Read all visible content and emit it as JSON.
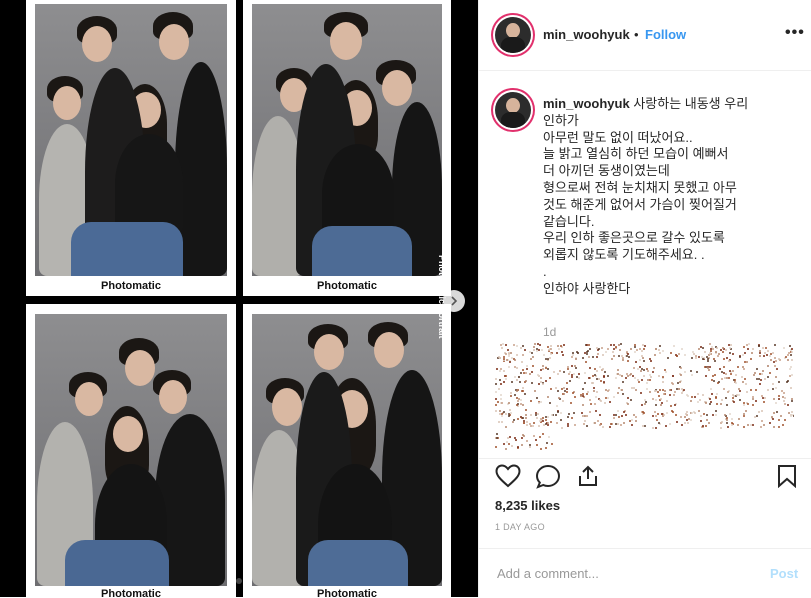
{
  "post": {
    "username": "min_woohyuk",
    "follow_label": "Follow",
    "separator": "•",
    "more_label": "•••",
    "caption_lines": [
      "사랑하는 내동생 우리",
      "인하가",
      "아무런 말도 없이 떠났어요..",
      "늘 밝고 열심히 하던 모습이 예뻐서",
      "더 아끼던 동생이였는데",
      "형으로써 전혀 눈치채지 못했고 아무",
      "것도 해준게 없어서 가슴이 찢어질거",
      "같습니다.",
      "우리 인하 좋은곳으로 갈수 있도록",
      "외롭지 않도록 기도해주세요. .",
      ".",
      "인하야 사랑한다"
    ],
    "caption_age": "1d",
    "likes": "8,235 likes",
    "date": "1 DAY AGO",
    "comment_placeholder": "Add a comment...",
    "post_label": "Post"
  },
  "photo": {
    "captions": [
      "Photomatic",
      "Photomatic",
      "Photomatic",
      "Photomatic"
    ],
    "side_label": "Photomatic Portrait",
    "next_icon": "chevron-right-icon"
  },
  "icons": {
    "like": "heart-icon",
    "comment": "comment-bubble-icon",
    "share": "share-icon",
    "save": "bookmark-icon"
  },
  "colors": {
    "accent": "#3897f0",
    "post_disabled": "#b2dffc",
    "muted": "#999999"
  }
}
